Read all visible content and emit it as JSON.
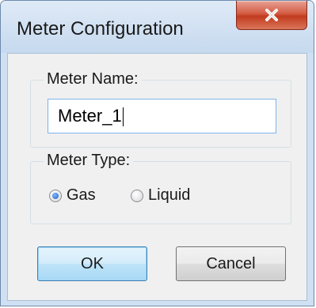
{
  "window": {
    "title": "Meter Configuration"
  },
  "meter_name": {
    "legend": "Meter Name:",
    "value": "Meter_1"
  },
  "meter_type": {
    "legend": "Meter Type:",
    "options": [
      {
        "label": "Gas",
        "selected": true
      },
      {
        "label": "Liquid",
        "selected": false
      }
    ]
  },
  "buttons": {
    "ok_label": "OK",
    "cancel_label": "Cancel"
  },
  "icons": {
    "close": "close-icon"
  },
  "colors": {
    "close_button": "#c84a30",
    "focus_border": "#3c7fb1",
    "input_border": "#7eb4ea"
  }
}
